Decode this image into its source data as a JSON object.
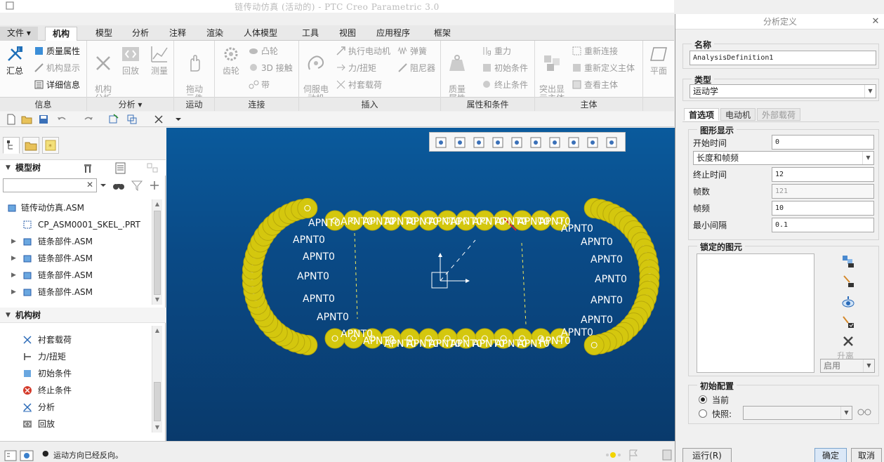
{
  "app": {
    "window_title": "链传动仿真 (活动的) - PTC Creo Parametric 3.0"
  },
  "ribbon": {
    "tabs": [
      "文件 ▾",
      "机构",
      "模型",
      "分析",
      "注释",
      "渲染",
      "人体模型",
      "工具",
      "视图",
      "应用程序",
      "框架"
    ],
    "groups": {
      "info": {
        "label": "信息",
        "summary": "汇总",
        "mass_props": "质量属性",
        "mech_display": "机构显示",
        "details": "详细信息"
      },
      "analysis": {
        "label": "分析 ▾",
        "mech_analysis": "机构\n分析",
        "playback": "回放",
        "measure": "测量"
      },
      "motion": {
        "label": "运动",
        "drag": "拖动\n元件"
      },
      "connect": {
        "label": "连接",
        "gear": "齿轮",
        "cam": "凸轮",
        "contact3d": "3D 接触",
        "belt": "带"
      },
      "insert": {
        "label": "插入",
        "servo": "伺服电\n动机",
        "exec_motor": "执行电动机",
        "spring": "弹簧",
        "force": "力/扭矩",
        "damper": "阻尼器",
        "bushing": "衬套载荷"
      },
      "props": {
        "label": "属性和条件",
        "mass": "质量\n属性",
        "gravity": "重力",
        "init_cond": "初始条件",
        "term_cond": "终止条件"
      },
      "body": {
        "label": "主体",
        "highlight": "突出显\n示主体",
        "reconnect": "重新连接",
        "redefine": "重新定义主体",
        "view_body": "查看主体"
      },
      "datum": {
        "plane": "平面"
      }
    }
  },
  "left_panel": {
    "model_tree": {
      "title": "模型树",
      "search_placeholder": "",
      "items": [
        {
          "label": "链传动仿真.ASM",
          "expandable": false
        },
        {
          "label": "CP_ASM0001_SKEL_.PRT",
          "expandable": false
        },
        {
          "label": "链条部件.ASM",
          "expandable": true
        },
        {
          "label": "链条部件.ASM",
          "expandable": true
        },
        {
          "label": "链条部件.ASM",
          "expandable": true
        },
        {
          "label": "链条部件.ASM",
          "expandable": true
        }
      ]
    },
    "mech_tree": {
      "title": "机构树",
      "items": [
        "衬套载荷",
        "力/扭矩",
        "初始条件",
        "终止条件",
        "分析",
        "回放"
      ]
    }
  },
  "viewport": {
    "point_label": "APNT0",
    "toolbar_icons": [
      "zoom-fit-icon",
      "zoom-in-icon",
      "zoom-out-icon",
      "repaint-icon",
      "view-orient-icon",
      "saved-views-icon",
      "display-style-icon",
      "datum-display-icon",
      "spin-center-icon",
      "annotation-icon"
    ]
  },
  "status": {
    "message": "运动方向已经反向。"
  },
  "dialog": {
    "title": "分析定义",
    "name_label": "名称",
    "name_value": "AnalysisDefinition1",
    "type_label": "类型",
    "type_value": "运动学",
    "tabs": [
      "首选项",
      "电动机",
      "外部载荷"
    ],
    "graph_display": {
      "legend": "图形显示",
      "start_time_label": "开始时间",
      "start_time": "0",
      "mode": "长度和帧频",
      "end_time_label": "终止时间",
      "end_time": "12",
      "frames_label": "帧数",
      "frames": "121",
      "frame_rate_label": "帧频",
      "frame_rate": "10",
      "min_interval_label": "最小间隔",
      "min_interval": "0.1"
    },
    "locked": {
      "legend": "锁定的图元",
      "release_label": "升离",
      "enable_value": "启用"
    },
    "initial_config": {
      "legend": "初始配置",
      "current": "当前",
      "snapshot": "快照:"
    },
    "buttons": {
      "run": "运行(R)",
      "ok": "确定",
      "cancel": "取消"
    }
  },
  "colors": {
    "chain": "#d4c70e",
    "viewport_top": "#0a5a9c",
    "viewport_bottom": "#093a6c"
  }
}
